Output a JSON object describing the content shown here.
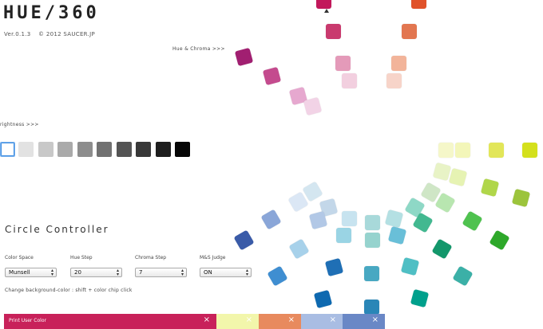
{
  "app": {
    "title": "HUE/360",
    "version": "Ver.0.1.3",
    "copyright": "© 2012 SAUCER.JP"
  },
  "links": {
    "hue_chroma": "Hue & Chroma >>>",
    "brightness": "rightness >>>"
  },
  "controller": {
    "title": "Circle Controller",
    "color_space": {
      "label": "Color Space",
      "value": "Munsell"
    },
    "hue_step": {
      "label": "Hue Step",
      "value": "20"
    },
    "chroma_step": {
      "label": "Chroma Step",
      "value": "7"
    },
    "ms_judge": {
      "label": "M&S Judge",
      "value": "ON"
    },
    "hint": "Change background-color : shift + color chip click"
  },
  "print_bar": {
    "label": "Print User Color",
    "close_icon": "×",
    "swatches": [
      "#c8215a",
      "#f2f6ab",
      "#e88a5e",
      "#a9bde3",
      "#6a88c6"
    ]
  },
  "brightness_chips": [
    "#ffffff",
    "#e2e2e2",
    "#c8c8c8",
    "#aaaaaa",
    "#8d8d8d",
    "#717171",
    "#545454",
    "#383838",
    "#1e1e1e",
    "#060606"
  ],
  "hue_chips": [
    "#c2185b",
    "#e0522a",
    "#c93a6e",
    "#e27650",
    "#a11f71",
    "#c44b8e",
    "#e49ab9",
    "#f2b49a",
    "#f2cfdf",
    "#f7d4c9",
    "#e6a8cf",
    "#f2d3e6",
    "#f5f7c9",
    "#f3f6b9",
    "#e2e659",
    "#d4e01c",
    "#e8f3c6",
    "#e6f3b3",
    "#b0d64a",
    "#9cc43c",
    "#cfe6c6",
    "#b8e6b0",
    "#4fc24f",
    "#2ea82a",
    "#d4e6f0",
    "#dbe7f5",
    "#c3d7e9",
    "#b2c8e6",
    "#c7e3ef",
    "#a8d9da",
    "#b4e0e3",
    "#8ed8c6",
    "#9ad4e4",
    "#96d3ce",
    "#69bfd8",
    "#42b890",
    "#a7d1ea",
    "#4fbfc4",
    "#3f8ed1",
    "#13976b",
    "#1f6fb5",
    "#48a8c2",
    "#3bb0a7",
    "#00a08c",
    "#0e69b0",
    "#2a86b7",
    "#1f8fb1",
    "#0a8f80",
    "#8aa6d8",
    "#6e8fcf",
    "#3a5ba8",
    "#a6c0e8"
  ]
}
